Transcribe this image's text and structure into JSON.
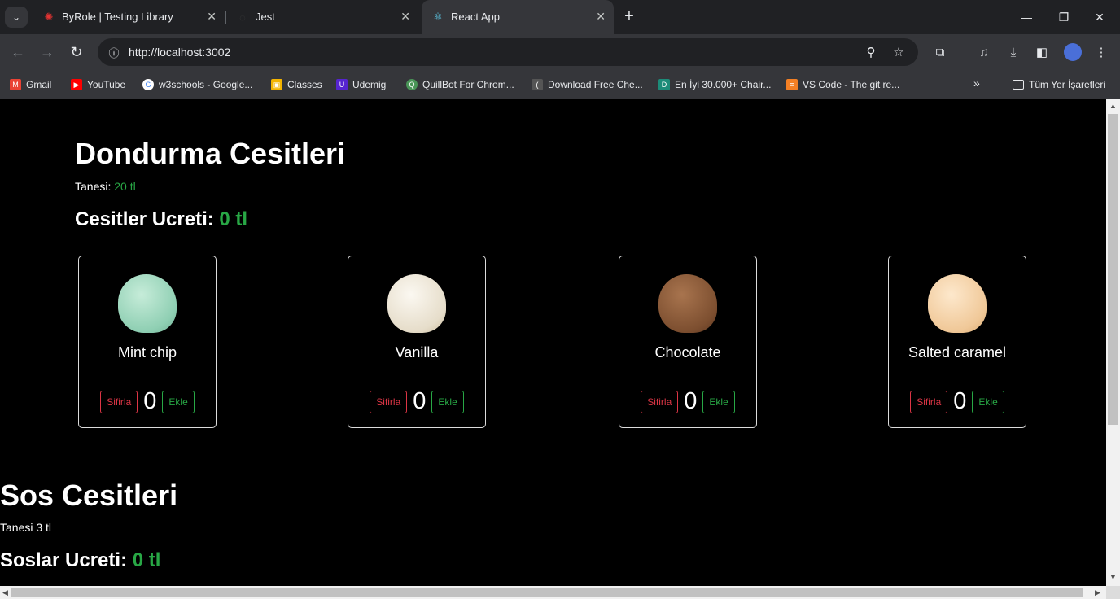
{
  "tabs": [
    {
      "title": "ByRole | Testing Library",
      "favicon": "octopus-icon"
    },
    {
      "title": "Jest",
      "favicon": "jest-icon"
    },
    {
      "title": "React App",
      "favicon": "react-icon"
    }
  ],
  "address_bar": {
    "url": "http://localhost:3002"
  },
  "bookmarks": [
    {
      "label": "Gmail",
      "icon": "gmail-icon",
      "color": "#ea4335"
    },
    {
      "label": "YouTube",
      "icon": "youtube-icon",
      "color": "#ff0000"
    },
    {
      "label": "w3schools - Google...",
      "icon": "google-icon",
      "color": "#4285f4"
    },
    {
      "label": "Classes",
      "icon": "classroom-icon",
      "color": "#f4b400"
    },
    {
      "label": "Udemig",
      "icon": "udemy-icon",
      "color": "#5624d0"
    },
    {
      "label": "QuillBot For Chrom...",
      "icon": "quillbot-icon",
      "color": "#499557"
    },
    {
      "label": "Download Free Che...",
      "icon": "bracket-icon",
      "color": "#555555"
    },
    {
      "label": "En İyi 30.000+ Chair...",
      "icon": "freepik-icon",
      "color": "#1273eb"
    },
    {
      "label": "VS Code - The git re...",
      "icon": "stackoverflow-icon",
      "color": "#f48024"
    }
  ],
  "bookmarks_folder": "Tüm Yer İşaretleri",
  "page": {
    "ice_title": "Dondurma Cesitleri",
    "ice_unit_label": "Tanesi:",
    "ice_unit_price": "20 tl",
    "ice_total_label": "Cesitler Ucreti:",
    "ice_total_value": "0 tl",
    "flavors": [
      {
        "name": "Mint chip",
        "count": "0",
        "color": "#a8dcc4"
      },
      {
        "name": "Vanilla",
        "count": "0",
        "color": "#ece6d8"
      },
      {
        "name": "Chocolate",
        "count": "0",
        "color": "#8a5a3a"
      },
      {
        "name": "Salted caramel",
        "count": "0",
        "color": "#f2cfa4"
      }
    ],
    "reset_label": "Sifirla",
    "add_label": "Ekle",
    "sauce_title": "Sos Cesitleri",
    "sauce_unit": "Tanesi 3 tl",
    "sauce_total_label": "Soslar Ucreti:",
    "sauce_total_value": "0 tl"
  },
  "colors": {
    "accent_green": "#28a745",
    "danger_red": "#dc3545"
  }
}
